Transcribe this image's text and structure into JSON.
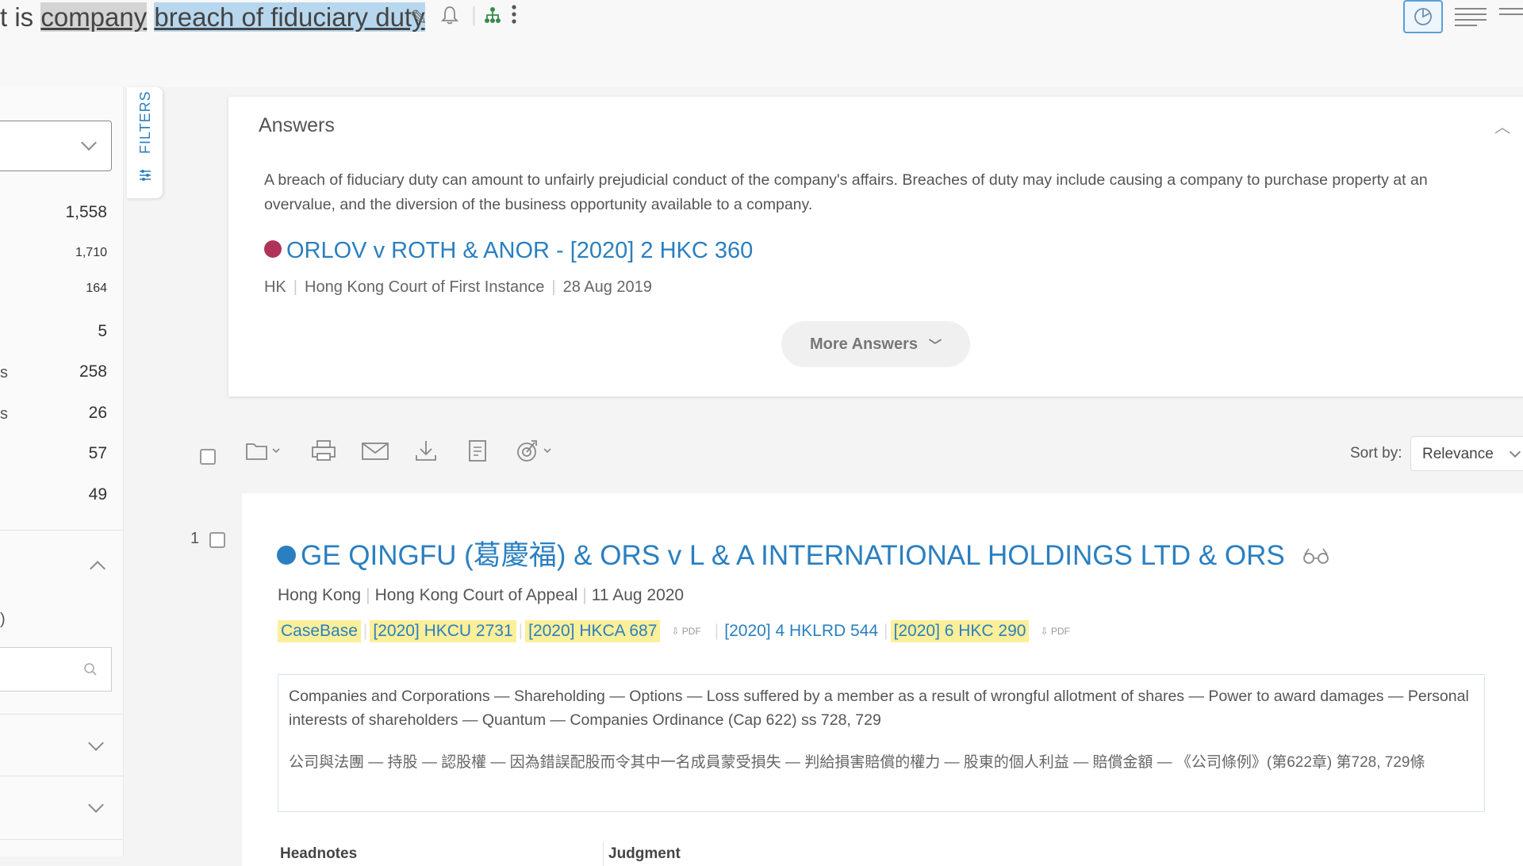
{
  "search": {
    "query_prefix": "t is ",
    "term1": "company",
    "term2": "breach of fiduciary duty"
  },
  "sidebar": {
    "counts": [
      "1,558",
      "1,710",
      "164",
      "5",
      "258",
      "26",
      "57",
      "49"
    ],
    "cut_labels": [
      "s",
      "s",
      ")"
    ]
  },
  "filters": {
    "label": "FILTERS"
  },
  "answers": {
    "title": "Answers",
    "text": "A breach of fiduciary duty can amount to unfairly prejudicial conduct of the company's affairs. Breaches of duty may include causing a company to purchase property at an overvalue, and the diversion of the business opportunity available to a company.",
    "case_title": "ORLOV v ROTH & ANOR - [2020] 2 HKC 360",
    "case_jurisdiction": "HK",
    "case_court": "Hong Kong Court of First Instance",
    "case_date": "28 Aug 2019",
    "more_button": "More Answers"
  },
  "toolbar": {
    "sort_label": "Sort by:",
    "sort_value": "Relevance"
  },
  "result": {
    "number": "1",
    "title": "GE QINGFU (葛慶福) & ORS v L & A INTERNATIONAL HOLDINGS LTD & ORS",
    "jurisdiction": "Hong Kong",
    "court": "Hong Kong Court of Appeal",
    "date": "11 Aug 2020",
    "citations": {
      "source": "CaseBase",
      "c1": "[2020] HKCU 2731",
      "c2": "[2020] HKCA 687",
      "c3": "[2020] 4 HKLRD 544",
      "c4": "[2020] 6 HKC 290",
      "pdf": "PDF"
    },
    "catchwords_en": "Companies and Corporations — Shareholding — Options — Loss suffered by a member as a result of wrongful allotment of shares — Power to award damages — Personal interests of shareholders — Quantum — Companies Ordinance (Cap 622) ss 728, 729",
    "catchwords_zh": "公司與法團 — 持股 — 認股權 — 因為錯誤配股而令其中一名成員蒙受損失 — 判給損害賠償的權力 — 股東的個人利益 — 賠償金額 — 《公司條例》(第622章) 第728, 729條",
    "tab_headnotes": "Headnotes",
    "tab_judgment": "Judgment"
  },
  "colors": {
    "link": "#2a7fc0",
    "highlight_term": "#b7d7ee",
    "highlight_cite": "#fcef9a",
    "answer_icon": "#b0335a",
    "result_icon": "#2a7fc0"
  }
}
